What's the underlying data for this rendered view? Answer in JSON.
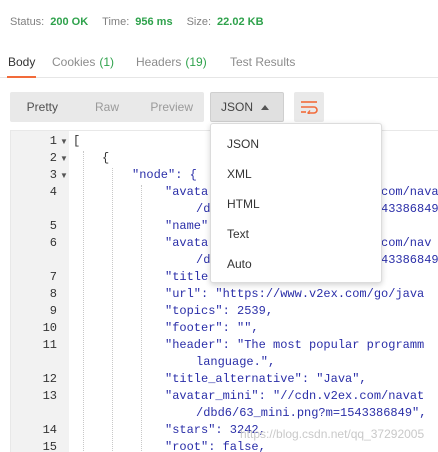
{
  "status": {
    "status_label": "Status:",
    "status_value": "200 OK",
    "time_label": "Time:",
    "time_value": "956 ms",
    "size_label": "Size:",
    "size_value": "22.02 KB"
  },
  "tabs": [
    {
      "label": "Body",
      "count": ""
    },
    {
      "label": "Cookies",
      "count": "(1)"
    },
    {
      "label": "Headers",
      "count": "(19)"
    },
    {
      "label": "Test Results",
      "count": ""
    }
  ],
  "view_modes": [
    "Pretty",
    "Raw",
    "Preview"
  ],
  "format_selected": "JSON",
  "format_options": [
    "JSON",
    "XML",
    "HTML",
    "Text",
    "Auto"
  ],
  "code_lines": [
    {
      "num": "1",
      "text": "["
    },
    {
      "num": "2",
      "text": "{"
    },
    {
      "num": "3",
      "text": "\"node\": {"
    },
    {
      "num": "4",
      "text": "\"avata"
    },
    {
      "num": "4b",
      "text": "/d"
    },
    {
      "num": "5",
      "text": "\"name\""
    },
    {
      "num": "6",
      "text": "\"avata"
    },
    {
      "num": "6b",
      "text": "/d"
    },
    {
      "num": "7",
      "text": "\"title"
    },
    {
      "num": "8",
      "text": "\"url\": \"https://www.v2ex.com/go/java"
    },
    {
      "num": "9",
      "text": "\"topics\": 2539,"
    },
    {
      "num": "10",
      "text": "\"footer\": \"\","
    },
    {
      "num": "11",
      "text": "\"header\": \"The most popular programm"
    },
    {
      "num": "11b",
      "text": "language.\","
    },
    {
      "num": "12",
      "text": "\"title_alternative\": \"Java\","
    },
    {
      "num": "13",
      "text": "\"avatar_mini\": \"//cdn.v2ex.com/navat"
    },
    {
      "num": "13b",
      "text": "/dbd6/63_mini.png?m=1543386849\","
    },
    {
      "num": "14",
      "text": "\"stars\": 3242,"
    },
    {
      "num": "15",
      "text": "\"root\": false,"
    }
  ],
  "code_tails": {
    "l4": "com/nava",
    "l4b": "43386849\"",
    "l6": "com/nav",
    "l6b": "43386849"
  },
  "watermark": "https://blog.csdn.net/qq_37292005"
}
